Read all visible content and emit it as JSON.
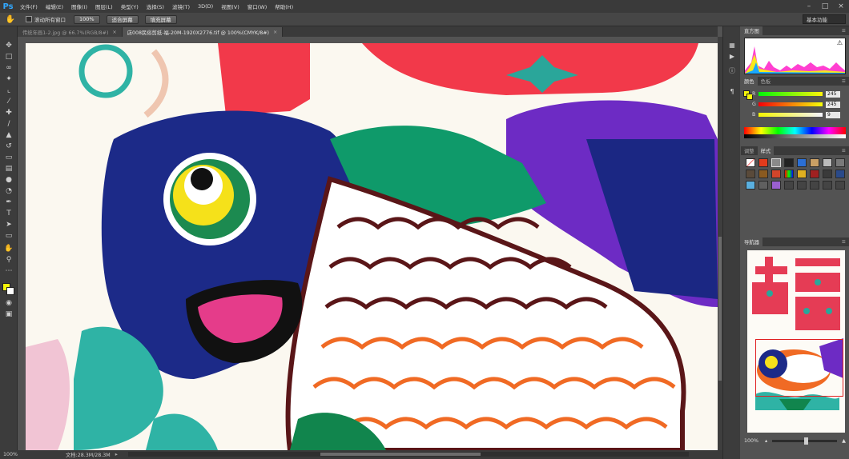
{
  "menubar": {
    "logo": "Ps",
    "items": [
      "文件(F)",
      "编辑(E)",
      "图像(I)",
      "图层(L)",
      "类型(Y)",
      "选择(S)",
      "滤镜(T)",
      "3D(D)",
      "视图(V)",
      "窗口(W)",
      "帮助(H)"
    ]
  },
  "options": {
    "scroll_all_label": "滚动所有窗口",
    "btn_100": "100%",
    "btn_fit": "适合屏幕",
    "btn_fill": "填充屏幕",
    "workspace": "基本功能"
  },
  "tabs": [
    {
      "label": "传统年画1-2.jpg @ 66.7%(RGB/8#)",
      "active": false
    },
    {
      "label": "店008民俗剪纸-福-20M-1920X2776.tif @ 100%(CMYK/8#)",
      "active": true
    }
  ],
  "status": {
    "zoom": "100%",
    "docsize": "文档:28.3M/28.3M"
  },
  "panels": {
    "histogram_tab": "直方图",
    "color_tab": "颜色",
    "swatches_tab": "色板",
    "adjust_tab": "调整",
    "styles_tab": "样式",
    "navigator_tab": "导航器",
    "navigator_zoom": "100%",
    "rgb": [
      {
        "label": "R",
        "value": "245"
      },
      {
        "label": "G",
        "value": "245"
      },
      {
        "label": "B",
        "value": "9"
      }
    ]
  },
  "colors": {
    "foreground": "#f5f509",
    "background": "#ffffff",
    "accent": "#31a8ff"
  }
}
